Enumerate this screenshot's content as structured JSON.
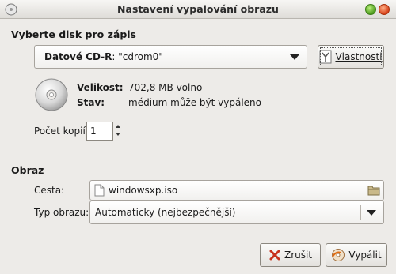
{
  "window": {
    "title": "Nastavení vypalování obrazu"
  },
  "disk_section": {
    "title": "Vyberte disk pro zápis",
    "drive_type": "Datové CD-R",
    "drive_name": ": \"cdrom0\"",
    "properties_label": "Vlastnosti"
  },
  "disc_info": {
    "size_label": "Velikost:",
    "size_value": "702,8 MB volno",
    "status_label": "Stav:",
    "status_value": "médium může být vypáleno"
  },
  "copies": {
    "label": "Počet kopií",
    "value": "1"
  },
  "image_section": {
    "title": "Obraz",
    "path_label": "Cesta:",
    "path_value": "windowsxp.iso",
    "type_label": "Typ obrazu:",
    "type_value": "Automaticky (nejbezpečnější)"
  },
  "buttons": {
    "cancel": "Zrušit",
    "burn": "Vypálit"
  },
  "colors": {
    "background": "#edebe8",
    "close_button": "#d8431b",
    "maximize_button": "#4c9a1d"
  },
  "icons": [
    "disc-burn-icon",
    "maximize-icon",
    "close-icon",
    "dropdown-arrow-icon",
    "properties-icon",
    "cd-disc-icon",
    "file-icon",
    "folder-icon",
    "cancel-x-icon",
    "burn-icon"
  ]
}
